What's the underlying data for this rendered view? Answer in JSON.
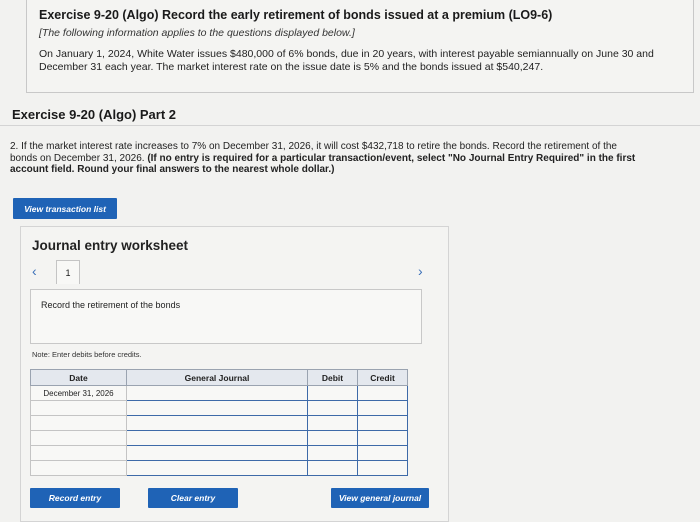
{
  "header": {
    "title": "Exercise 9-20 (Algo) Record the early retirement of bonds issued at a premium (LO9-6)",
    "subtitle": "[The following information applies to the questions displayed below.]",
    "body": "On January 1, 2024, White Water issues $480,000 of 6% bonds, due in 20 years, with interest payable semiannually on June 30 and December 31 each year. The market interest rate on the issue date is 5% and the bonds issued at $540,247."
  },
  "part_title": "Exercise 9-20 (Algo) Part 2",
  "question": {
    "plain": "2. If the market interest rate increases to 7% on December 31, 2026, it will cost $432,718 to retire the bonds. Record the retirement of the bonds on December 31, 2026. ",
    "bold": "(If no entry is required for a particular transaction/event, select \"No Journal Entry Required\" in the first account field. Round your final answers to the nearest whole dollar.)"
  },
  "buttons": {
    "view_transaction_list": "View transaction list",
    "record_entry": "Record entry",
    "clear_entry": "Clear entry",
    "view_general_journal": "View general journal"
  },
  "worksheet": {
    "title": "Journal entry worksheet",
    "page_number": "1",
    "record_prompt": "Record the retirement of the bonds",
    "note": "Note: Enter debits before credits."
  },
  "journal_table": {
    "headers": {
      "date": "Date",
      "general_journal": "General Journal",
      "debit": "Debit",
      "credit": "Credit"
    },
    "rows": [
      {
        "date": "December 31, 2026",
        "account": "",
        "debit": "",
        "credit": ""
      },
      {
        "date": "",
        "account": "",
        "debit": "",
        "credit": ""
      },
      {
        "date": "",
        "account": "",
        "debit": "",
        "credit": ""
      },
      {
        "date": "",
        "account": "",
        "debit": "",
        "credit": ""
      },
      {
        "date": "",
        "account": "",
        "debit": "",
        "credit": ""
      },
      {
        "date": "",
        "account": "",
        "debit": "",
        "credit": ""
      }
    ]
  },
  "icons": {
    "prev": "chevron-left-icon",
    "next": "chevron-right-icon"
  },
  "colors": {
    "button_blue": "#1f63b6",
    "cell_border_blue": "#3e6aa8",
    "nav_blue": "#3a6fb8"
  }
}
